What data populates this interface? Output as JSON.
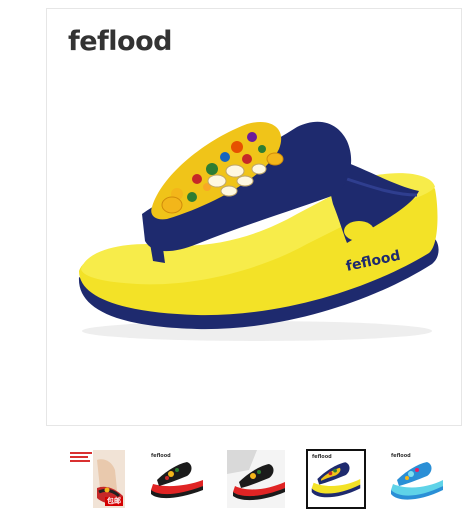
{
  "gallery": {
    "brand_logo": "feflood",
    "sole_brand": "feflood",
    "zoom_icon": "magnifier-icon",
    "thumbnails": [
      {
        "name": "thumb-1",
        "brand": "",
        "badge": "包邮",
        "active": false,
        "colors": {
          "strap": "#c62828",
          "sole": "#e53935"
        }
      },
      {
        "name": "thumb-2",
        "brand": "feflood",
        "badge": "",
        "active": false,
        "colors": {
          "strap": "#1b1b1b",
          "sole": "#e02424"
        }
      },
      {
        "name": "thumb-3",
        "brand": "",
        "badge": "",
        "active": false,
        "colors": {
          "strap": "#1b1b1b",
          "sole": "#e02424"
        }
      },
      {
        "name": "thumb-4",
        "brand": "feflood",
        "badge": "",
        "active": true,
        "colors": {
          "strap": "#1e2a6e",
          "sole": "#f3e227"
        }
      },
      {
        "name": "thumb-5",
        "brand": "feflood",
        "badge": "",
        "active": false,
        "colors": {
          "strap": "#2a8fd6",
          "sole": "#5fd3e8"
        }
      }
    ]
  },
  "colors": {
    "sole_yellow": "#f3e227",
    "strap_navy": "#1e2a6e",
    "frame_border": "#e6e6e6",
    "active_border": "#111111"
  }
}
